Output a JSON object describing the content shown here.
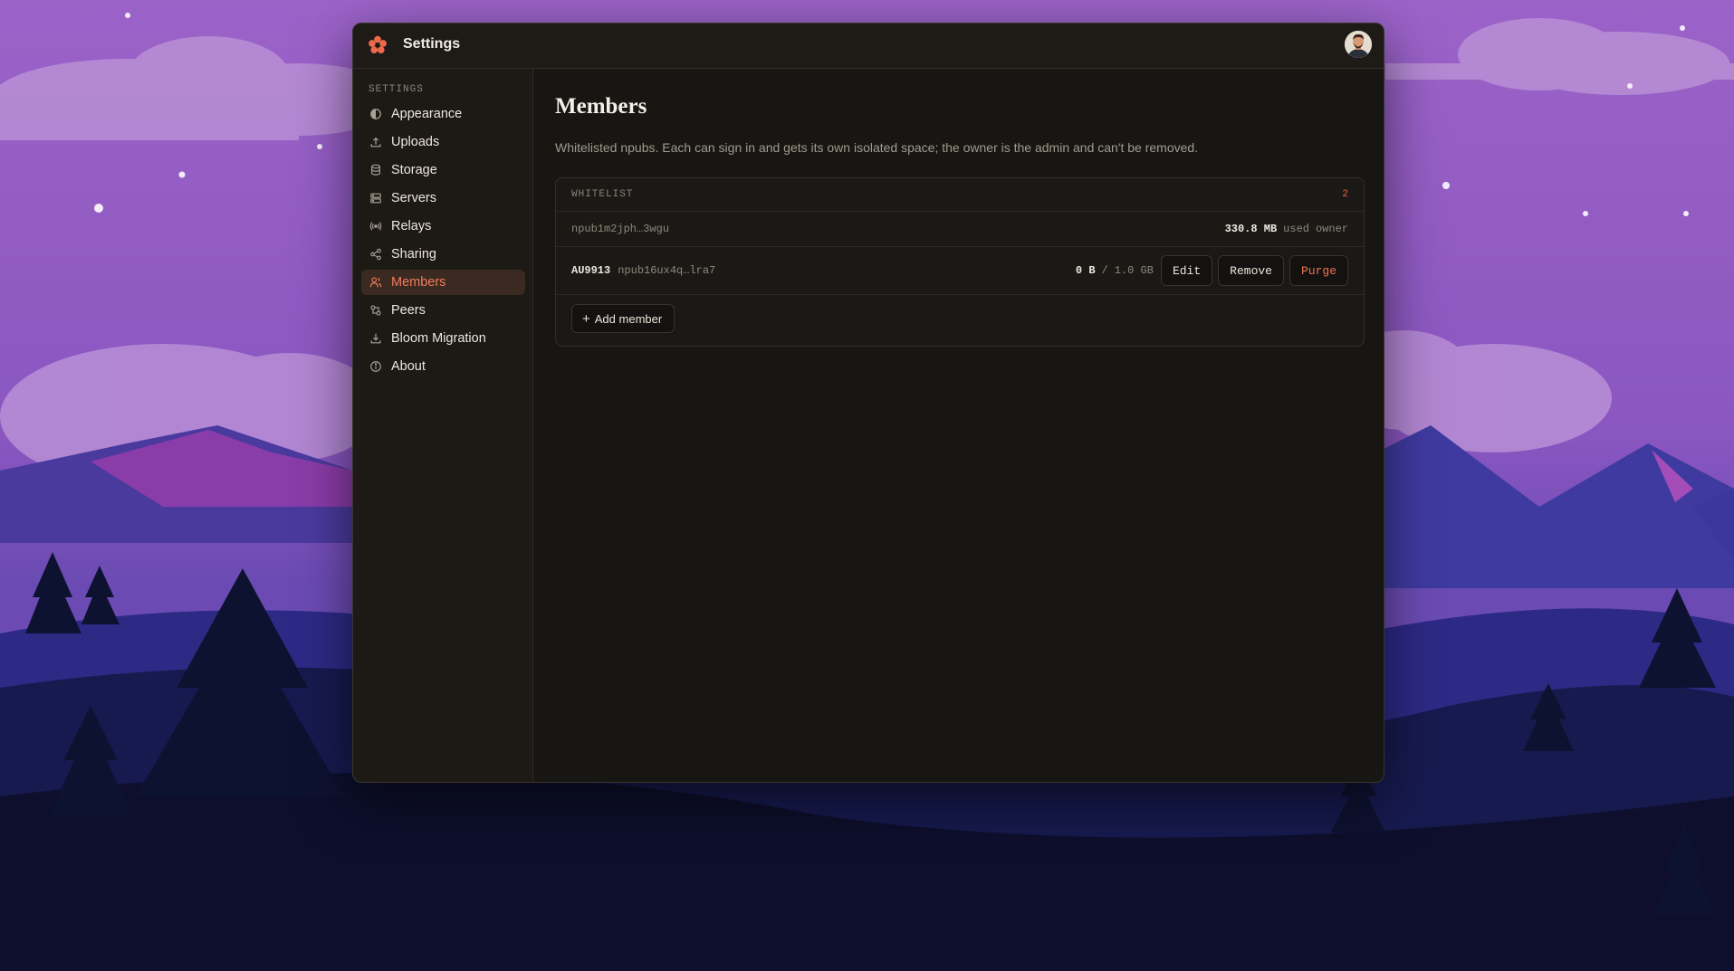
{
  "window": {
    "title": "Settings"
  },
  "sidebar": {
    "heading": "SETTINGS",
    "items": [
      {
        "label": "Appearance",
        "icon": "contrast-icon"
      },
      {
        "label": "Uploads",
        "icon": "upload-icon"
      },
      {
        "label": "Storage",
        "icon": "database-icon"
      },
      {
        "label": "Servers",
        "icon": "server-icon"
      },
      {
        "label": "Relays",
        "icon": "radio-icon"
      },
      {
        "label": "Sharing",
        "icon": "share-icon"
      },
      {
        "label": "Members",
        "icon": "users-icon",
        "active": true
      },
      {
        "label": "Peers",
        "icon": "peers-icon"
      },
      {
        "label": "Bloom Migration",
        "icon": "download-icon"
      },
      {
        "label": "About",
        "icon": "info-icon"
      }
    ]
  },
  "main": {
    "title": "Members",
    "description": "Whitelisted npubs. Each can sign in and gets its own isolated space; the owner is the admin and can't be removed.",
    "whitelist": {
      "heading": "WHITELIST",
      "count": "2",
      "owner_row": {
        "npub": "npub1m2jph…3wgu",
        "usage": "330.8 MB",
        "usage_suffix": "used",
        "role": "owner"
      },
      "member_row": {
        "name": "AU9913",
        "npub": "npub16ux4q…lra7",
        "used": "0 B",
        "separator": "/",
        "quota": "1.0 GB",
        "edit_label": "Edit",
        "remove_label": "Remove",
        "purge_label": "Purge"
      }
    },
    "add_member_label": "Add member"
  },
  "colors": {
    "accent": "#f07c5a",
    "danger": "#ee7653",
    "background": "#181612"
  }
}
